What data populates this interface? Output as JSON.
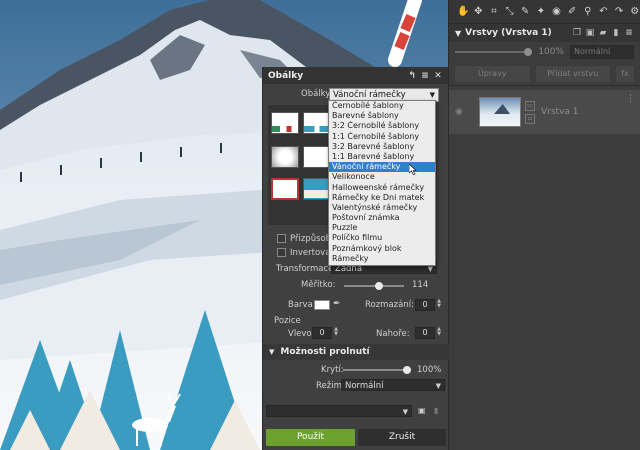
{
  "colors": {
    "accent_green": "#6aa12f",
    "selection_blue": "#2f7fd3",
    "panel_bg": "#404040",
    "frame_blue": "#3a9cc0"
  },
  "toolbar_icons": [
    "hand-icon",
    "move-icon",
    "crop-icon",
    "transform-icon",
    "pin-icon",
    "wand-icon",
    "eye-icon",
    "brush-icon",
    "dropper-icon",
    "undo-icon",
    "redo-icon",
    "settings-icon"
  ],
  "layers_panel": {
    "title": "Vrstvy (Vrstva 1)",
    "opacity": "100%",
    "blend_mode": "Normální",
    "tabs": [
      "Úpravy",
      "Přidat vrstvu",
      "fx"
    ],
    "layer": {
      "name": "Vrstva 1"
    }
  },
  "dialog": {
    "title": "Obálky",
    "frames_label": "Obálky:",
    "frames_value": "Vánoční rámečky",
    "options": [
      "Černobílé šablony",
      "Barevné šablony",
      "3:2 Černobílé šablony",
      "1:1 Černobílé šablony",
      "3:2 Barevné šablony",
      "1:1 Barevné šablony",
      "Vánoční rámečky",
      "Velikonoce",
      "Halloweenské rámečky",
      "Rámečky ke Dni matek",
      "Valentýnské rámečky",
      "Poštovní známka",
      "Puzzle",
      "Políčko filmu",
      "Poznámkový blok",
      "Rámečky"
    ],
    "selected_index": 6,
    "fit_label": "Přizpůsobit p",
    "invert_label": "Invertovat",
    "transform_label": "Transformace:",
    "transform_value": "Žádná",
    "scale_label": "Měřítko:",
    "scale_value": "114",
    "scale_fraction": 0.58,
    "color_label": "Barva:",
    "color_value": "#ffffff",
    "blur_label": "Rozmazání:",
    "blur_value": "0",
    "position_label": "Pozice",
    "left_label": "Vlevo:",
    "left_value": "0",
    "top_label": "Nahoře:",
    "top_value": "0",
    "blend_section": "Možnosti prolnutí",
    "opacity_label": "Krytí:",
    "opacity_value": "100%",
    "opacity_fraction": 1.0,
    "mode_label": "Režim:",
    "mode_value": "Normální",
    "preset_value": "",
    "apply_label": "Použít",
    "cancel_label": "Zrušit"
  }
}
